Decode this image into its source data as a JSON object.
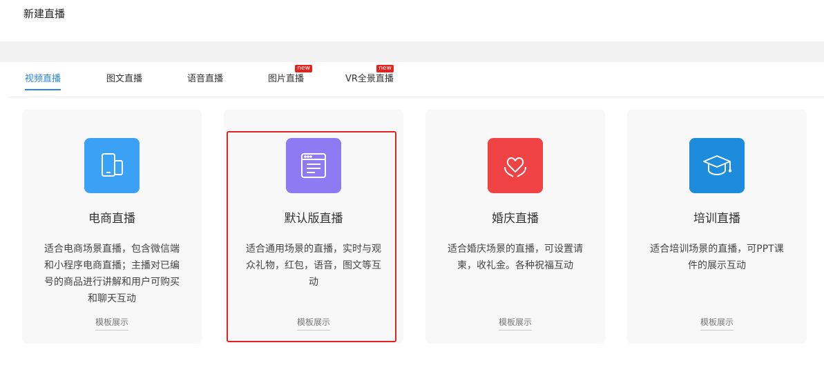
{
  "page": {
    "title": "新建直播"
  },
  "tabs": [
    {
      "label": "视频直播",
      "active": true,
      "badge": ""
    },
    {
      "label": "图文直播",
      "active": false,
      "badge": ""
    },
    {
      "label": "语音直播",
      "active": false,
      "badge": ""
    },
    {
      "label": "图片直播",
      "active": false,
      "badge": "new"
    },
    {
      "label": "VR全景直播",
      "active": false,
      "badge": "new"
    }
  ],
  "cards": [
    {
      "title": "电商直播",
      "description": "适合电商场景直播，包含微信端和小程序电商直播；主播对已编号的商品进行讲解和用户可购买和聊天互动",
      "link": "模板展示",
      "icon": "mobile-devices-icon",
      "color": "#3aa1f4"
    },
    {
      "title": "默认版直播",
      "description": "适合通用场景的直播，实时与观众礼物，红包，语音，图文等互动",
      "link": "模板展示",
      "icon": "browser-window-icon",
      "color": "#8e7bf3",
      "selected": true
    },
    {
      "title": "婚庆直播",
      "description": "适合婚庆场景的直播，可设置请柬，收礼金。各种祝福互动",
      "link": "模板展示",
      "icon": "heart-hands-icon",
      "color": "#ef4346"
    },
    {
      "title": "培训直播",
      "description": "适合培训场景的直播，可PPT课件的展示互动",
      "link": "模板展示",
      "icon": "graduation-cap-icon",
      "color": "#1e8cdc"
    }
  ],
  "colors": {
    "accent": "#2a86e0",
    "badge": "#e8211d",
    "highlight": "#e02424"
  }
}
